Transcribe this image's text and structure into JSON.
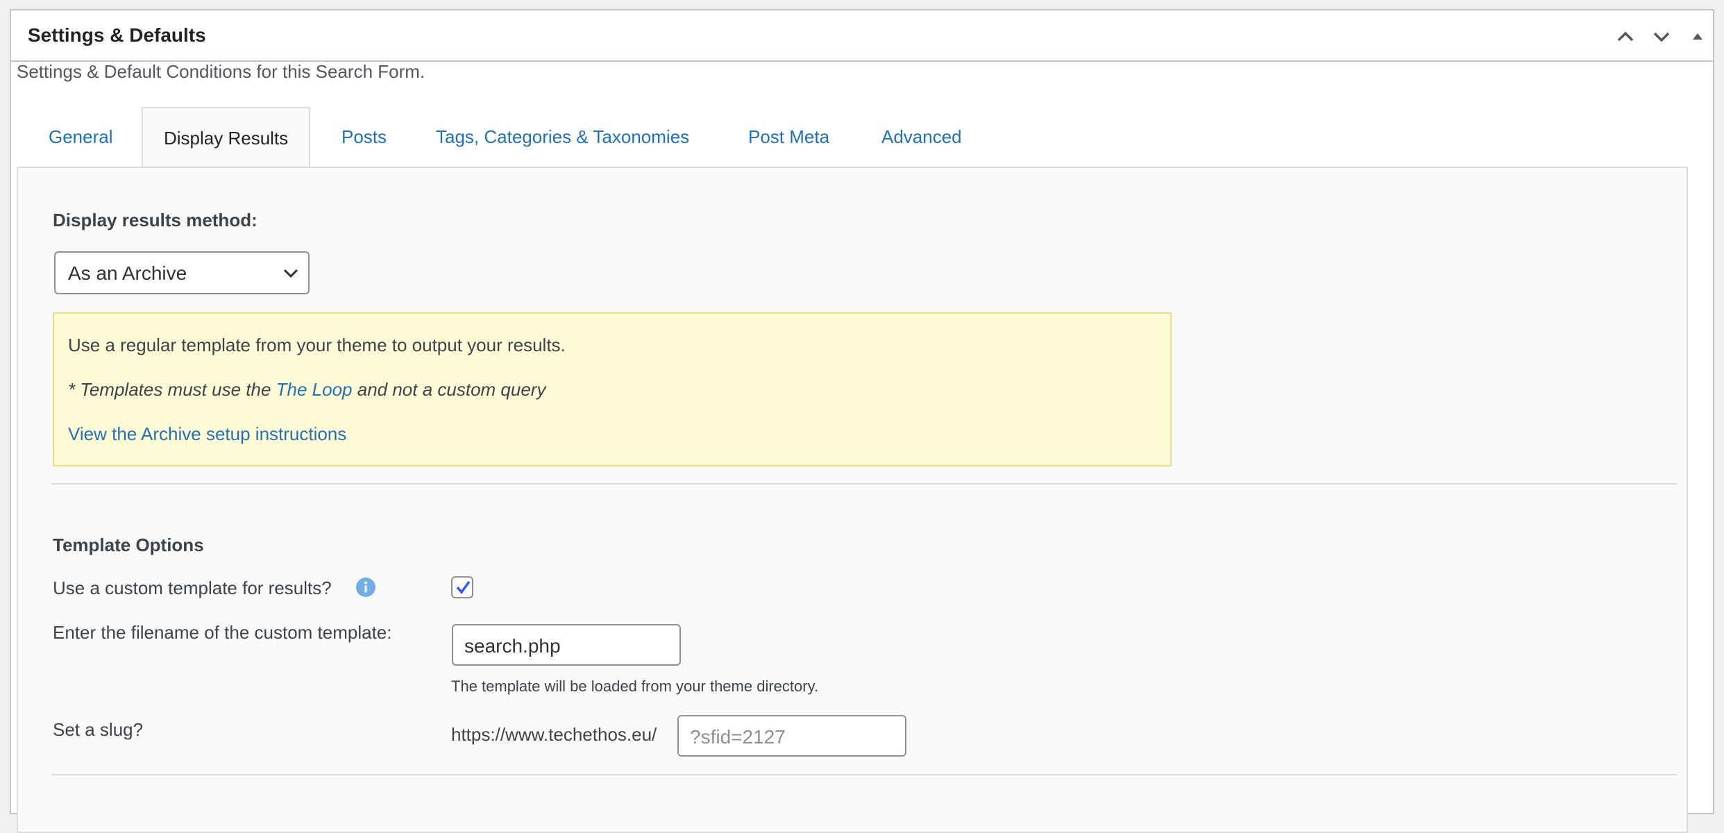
{
  "metabox": {
    "title": "Settings & Defaults",
    "description": "Settings & Default Conditions for this Search Form."
  },
  "tabs": [
    {
      "label": "General"
    },
    {
      "label": "Display Results",
      "active": true
    },
    {
      "label": "Posts"
    },
    {
      "label": "Tags, Categories & Taxonomies"
    },
    {
      "label": "Post Meta"
    },
    {
      "label": "Advanced"
    }
  ],
  "display": {
    "label": "Display results method:",
    "selected": "As an Archive"
  },
  "notice": {
    "line1": "Use a regular template from your theme to output your results.",
    "line2_pre": "* Templates must use the ",
    "line2_link": "The Loop",
    "line2_post": " and not a custom query",
    "link": "View the Archive setup instructions"
  },
  "template_options": {
    "title": "Template Options",
    "custom_template_label": "Use a custom template for results?",
    "custom_template_checked": true,
    "filename_label": "Enter the filename of the custom template:",
    "filename_value": "search.php",
    "filename_help": "The template will be loaded from your theme directory.",
    "slug_label": "Set a slug?",
    "slug_prefix": "https://www.techethos.eu/",
    "slug_placeholder": "?sfid=2127"
  },
  "colors": {
    "link": "#2271b1",
    "notice_bg": "#fffbd6",
    "checkbox_accent": "#3858e9",
    "info_icon": "#72aee6"
  }
}
